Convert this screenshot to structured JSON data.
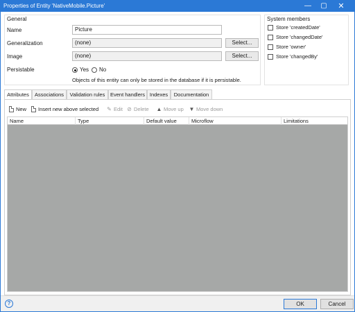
{
  "window": {
    "title": "Properties of Entity 'NativeMobile.Picture'",
    "minimize_glyph": "—",
    "maximize_glyph": "▢",
    "close_glyph": "✕"
  },
  "general": {
    "title": "General",
    "name_label": "Name",
    "name_value": "Picture",
    "generalization_label": "Generalization",
    "generalization_value": "(none)",
    "generalization_button": "Select...",
    "image_label": "Image",
    "image_value": "(none)",
    "image_button": "Select...",
    "persistable_label": "Persistable",
    "persistable_yes": "Yes",
    "persistable_no": "No",
    "persistable_selected": "Yes",
    "note": "Objects of this entity can only be stored in the database if it is persistable."
  },
  "system_members": {
    "title": "System members",
    "items": [
      {
        "label": "Store 'createdDate'",
        "checked": false
      },
      {
        "label": "Store 'changedDate'",
        "checked": false
      },
      {
        "label": "Store 'owner'",
        "checked": false
      },
      {
        "label": "Store 'changedBy'",
        "checked": false
      }
    ]
  },
  "tabs": [
    {
      "label": "Attributes",
      "active": true
    },
    {
      "label": "Associations",
      "active": false
    },
    {
      "label": "Validation rules",
      "active": false
    },
    {
      "label": "Event handlers",
      "active": false
    },
    {
      "label": "Indexes",
      "active": false
    },
    {
      "label": "Documentation",
      "active": false
    }
  ],
  "toolbar": {
    "new_label": "New",
    "insert_label": "Insert new above selected",
    "edit_label": "Edit",
    "delete_label": "Delete",
    "move_up_label": "Move up",
    "move_down_label": "Move down"
  },
  "grid": {
    "columns": [
      "Name",
      "Type",
      "Default value",
      "Microflow",
      "Limitations"
    ],
    "rows": [],
    "empty_color": "#a6a8a7"
  },
  "footer": {
    "help_glyph": "?",
    "ok_label": "OK",
    "cancel_label": "Cancel"
  },
  "colors": {
    "accent": "#2b79d6"
  }
}
